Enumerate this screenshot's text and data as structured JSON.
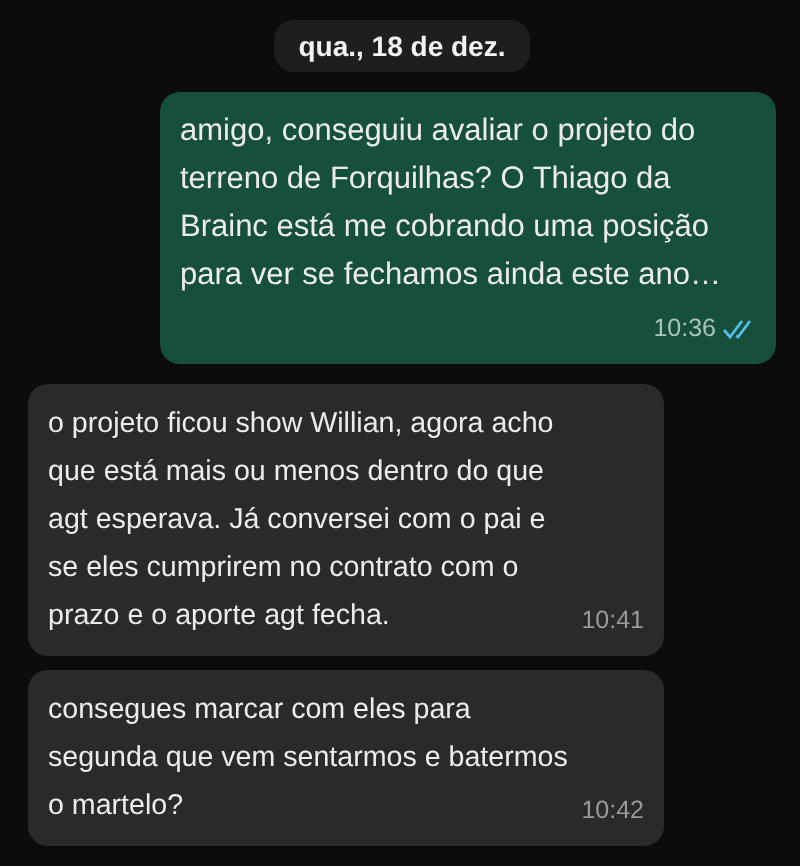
{
  "date_divider": "qua., 18 de dez.",
  "messages": [
    {
      "kind": "outgoing",
      "text": "amigo, conseguiu avaliar o projeto do terreno de Forquilhas? O Thiago da Brainc está me cobrando uma posição para ver se fechamos ainda este ano…",
      "time": "10:36",
      "read": true
    },
    {
      "kind": "incoming",
      "text": "o projeto ficou show Willian, agora acho que está mais ou menos dentro do que agt esperava. Já conversei com o pai e se eles cumprirem no contrato com o prazo e o aporte agt fecha.",
      "time": "10:41"
    },
    {
      "kind": "incoming",
      "text": "consegues marcar com eles para segunda que vem sentarmos e batermos o martelo?",
      "time": "10:42"
    }
  ]
}
